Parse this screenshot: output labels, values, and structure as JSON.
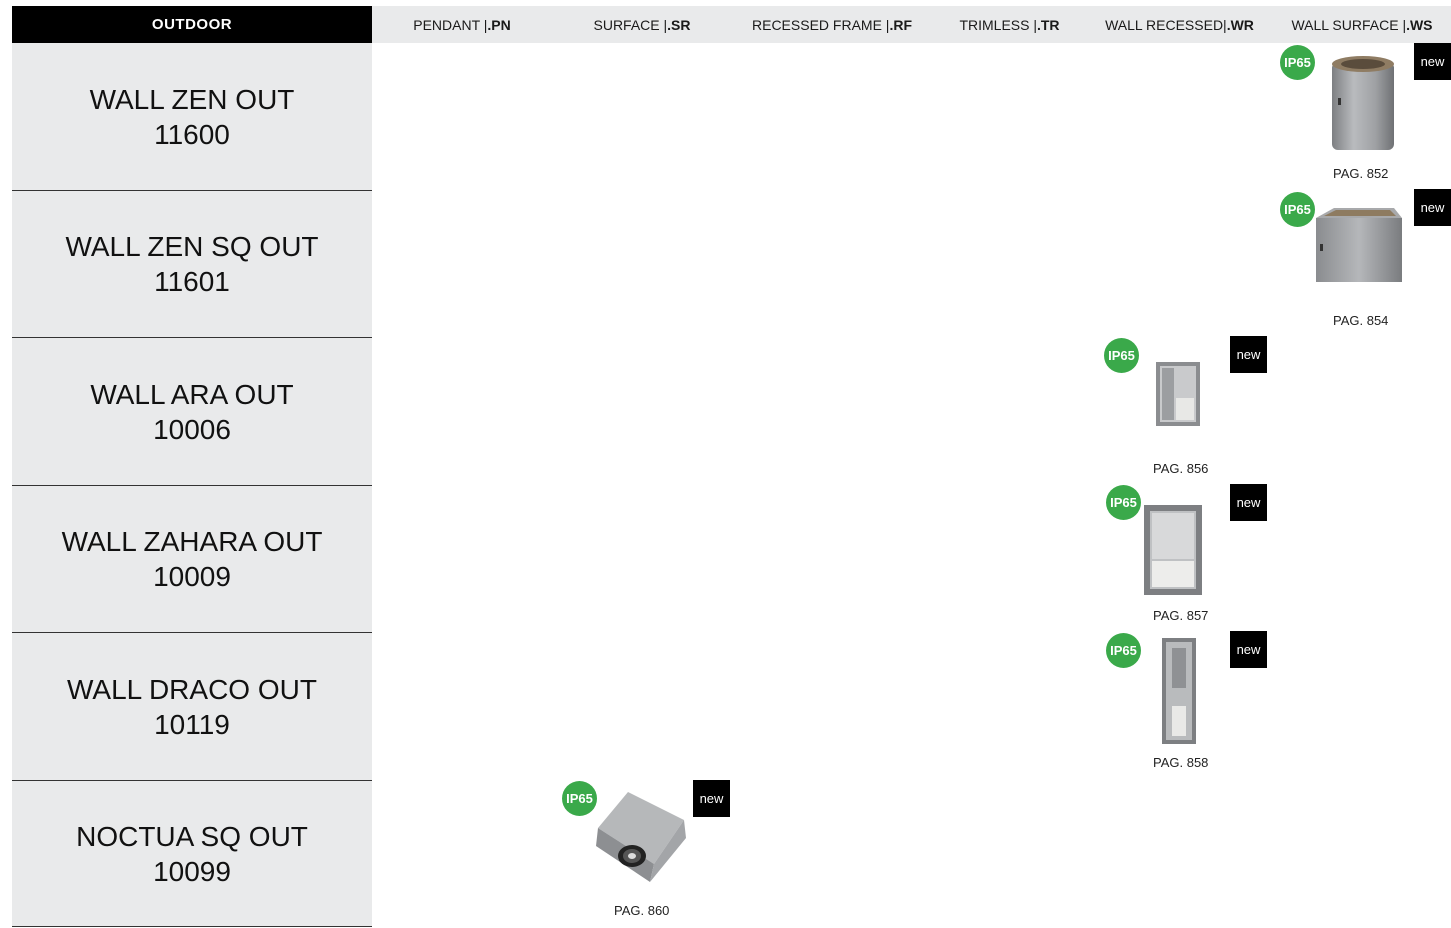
{
  "header": {
    "section": "OUTDOOR",
    "columns": [
      {
        "name": "PENDANT | ",
        "code": ".PN"
      },
      {
        "name": "SURFACE | ",
        "code": ".SR"
      },
      {
        "name": "RECESSED FRAME | ",
        "code": ".RF"
      },
      {
        "name": "TRIMLESS | ",
        "code": ".TR"
      },
      {
        "name": "WALL RECESSED| ",
        "code": ".WR"
      },
      {
        "name": "WALL SURFACE | ",
        "code": ".WS"
      }
    ]
  },
  "rows": [
    {
      "name": "WALL ZEN OUT",
      "code": "11600",
      "column": "WALL SURFACE",
      "ip": "IP65",
      "badge": "new",
      "page": "PAG. 852",
      "shape": "cylinder"
    },
    {
      "name": "WALL ZEN SQ OUT",
      "code": "11601",
      "column": "WALL SURFACE",
      "ip": "IP65",
      "badge": "new",
      "page": "PAG. 854",
      "shape": "cube"
    },
    {
      "name": "WALL ARA OUT",
      "code": "10006",
      "column": "WALL RECESSED",
      "ip": "IP65",
      "badge": "new",
      "page": "PAG. 856",
      "shape": "recessed-small"
    },
    {
      "name": "WALL ZAHARA OUT",
      "code": "10009",
      "column": "WALL RECESSED",
      "ip": "IP65",
      "badge": "new",
      "page": "PAG. 857",
      "shape": "recessed-wide"
    },
    {
      "name": "WALL DRACO OUT",
      "code": "10119",
      "column": "WALL RECESSED",
      "ip": "IP65",
      "badge": "new",
      "page": "PAG. 858",
      "shape": "recessed-tall"
    },
    {
      "name": "NOCTUA SQ OUT",
      "code": "10099",
      "column": "SURFACE",
      "ip": "IP65",
      "badge": "new",
      "page": "PAG. 860",
      "shape": "spot-cube"
    }
  ],
  "colors": {
    "ip_badge": "#3aa94a",
    "header_black": "#000000",
    "row_bg": "#e9eaeb"
  }
}
